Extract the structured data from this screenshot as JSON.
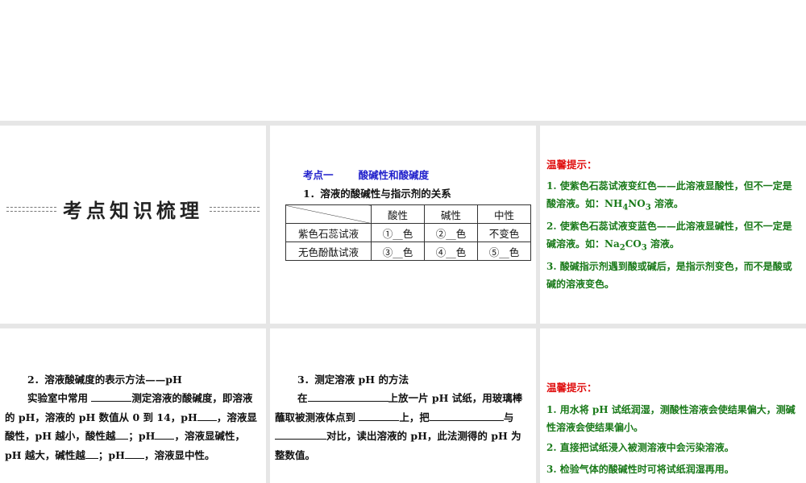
{
  "panel1": {
    "title": "考点知识梳理"
  },
  "panel2": {
    "section_label": "考点一",
    "section_title": "酸碱性和酸碱度",
    "heading": "1．溶液的酸碱性与指示剂的关系",
    "table": {
      "headers": [
        "酸性",
        "碱性",
        "中性"
      ],
      "rows": [
        [
          "紫色石蕊试液",
          "①__色",
          "②__色",
          "不变色"
        ],
        [
          "无色酚酞试液",
          "③__色",
          "④__色",
          "⑤__色"
        ]
      ]
    }
  },
  "panel3": {
    "tip_title": "温馨提示：",
    "tips": [
      {
        "text": "1. 使紫色石蕊试液变红色——此溶液显酸性，但不一定是酸溶液。如：",
        "f1": "NH",
        "s1": "4",
        "f2": "NO",
        "s2": "3",
        "post": " 溶液。"
      },
      {
        "text": "2. 使紫色石蕊试液变蓝色——此溶液显碱性，但不一定是碱溶液。如：",
        "f1": "Na",
        "s1": "2",
        "f2": "CO",
        "s2": "3",
        "post": " 溶液。"
      },
      {
        "text": "3. 酸碱指示剂遇到酸或碱后，是指示剂变色，而不是酸或碱的溶液变色。"
      }
    ]
  },
  "panel4": {
    "heading": "2．溶液酸碱度的表示方法——pH",
    "segments": [
      "实验室中常用 ",
      "测定溶液的酸碱度，即溶液的 pH，溶液的 pH 数值从 0 到 14，pH",
      "，溶液显酸性，pH 越小，酸性越",
      "；pH",
      "，溶液显碱性，pH 越大，碱性越",
      "；pH",
      "，溶液显中性。"
    ]
  },
  "panel5": {
    "heading": "3．测定溶液 pH 的方法",
    "segments": [
      "在",
      "上放一片 pH 试纸，用玻璃棒蘸取被测液体点到 ",
      "上，把",
      "与",
      "对比，读出溶液的 pH，此法测得的 pH 为整数值。"
    ]
  },
  "panel6": {
    "tip_title": "温馨提示：",
    "tips": [
      "1. 用水将 pH 试纸润湿，测酸性溶液会使结果偏大，测碱性溶液会使结果偏小。",
      "2. 直接把试纸浸入被测溶液中会污染溶液。",
      "3. 检验气体的酸碱性时可将试纸润湿再用。"
    ]
  }
}
